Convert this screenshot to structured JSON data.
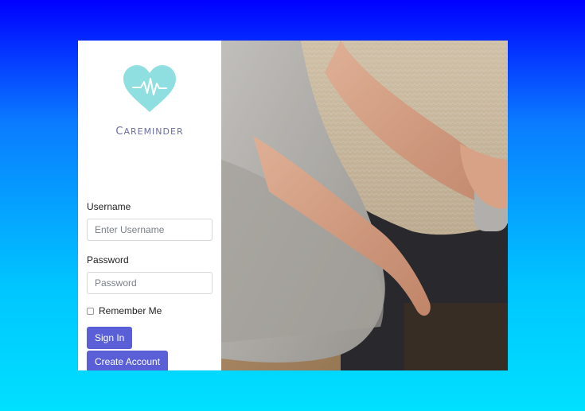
{
  "brand": {
    "name_first": "C",
    "name_rest": "areminder",
    "logo_icon": "heart-pulse-icon",
    "logo_color": "#8fdfe0"
  },
  "form": {
    "username_label": "Username",
    "username_placeholder": "Enter Username",
    "password_label": "Password",
    "password_placeholder": "Password",
    "remember_label": "Remember Me",
    "signin_label": "Sign In",
    "create_account_label": "Create Account"
  },
  "colors": {
    "button": "#5a5fd8",
    "background_top": "#0000ff",
    "background_bottom": "#00e0ff"
  }
}
